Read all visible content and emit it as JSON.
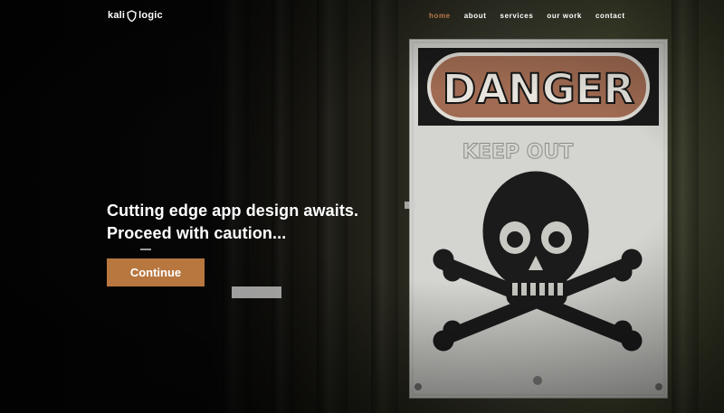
{
  "brand": {
    "name_left": "kali",
    "name_right": "logic"
  },
  "nav": {
    "items": [
      {
        "label": "home",
        "active": true
      },
      {
        "label": "about",
        "active": false
      },
      {
        "label": "services",
        "active": false
      },
      {
        "label": "our work",
        "active": false
      },
      {
        "label": "contact",
        "active": false
      }
    ]
  },
  "hero": {
    "line1": "Cutting edge app design awaits.",
    "line2": "Proceed with caution...",
    "cta_label": "Continue"
  },
  "sign": {
    "heading": "DANGER",
    "subtext": "KEEP OUT"
  },
  "colors": {
    "accent": "#b8773f",
    "nav_active": "#b8784a",
    "sign_header": "#a06b52"
  },
  "icons": {
    "logo_mark": "shield-outline-icon",
    "sign_symbol": "skull-crossbones-icon"
  }
}
